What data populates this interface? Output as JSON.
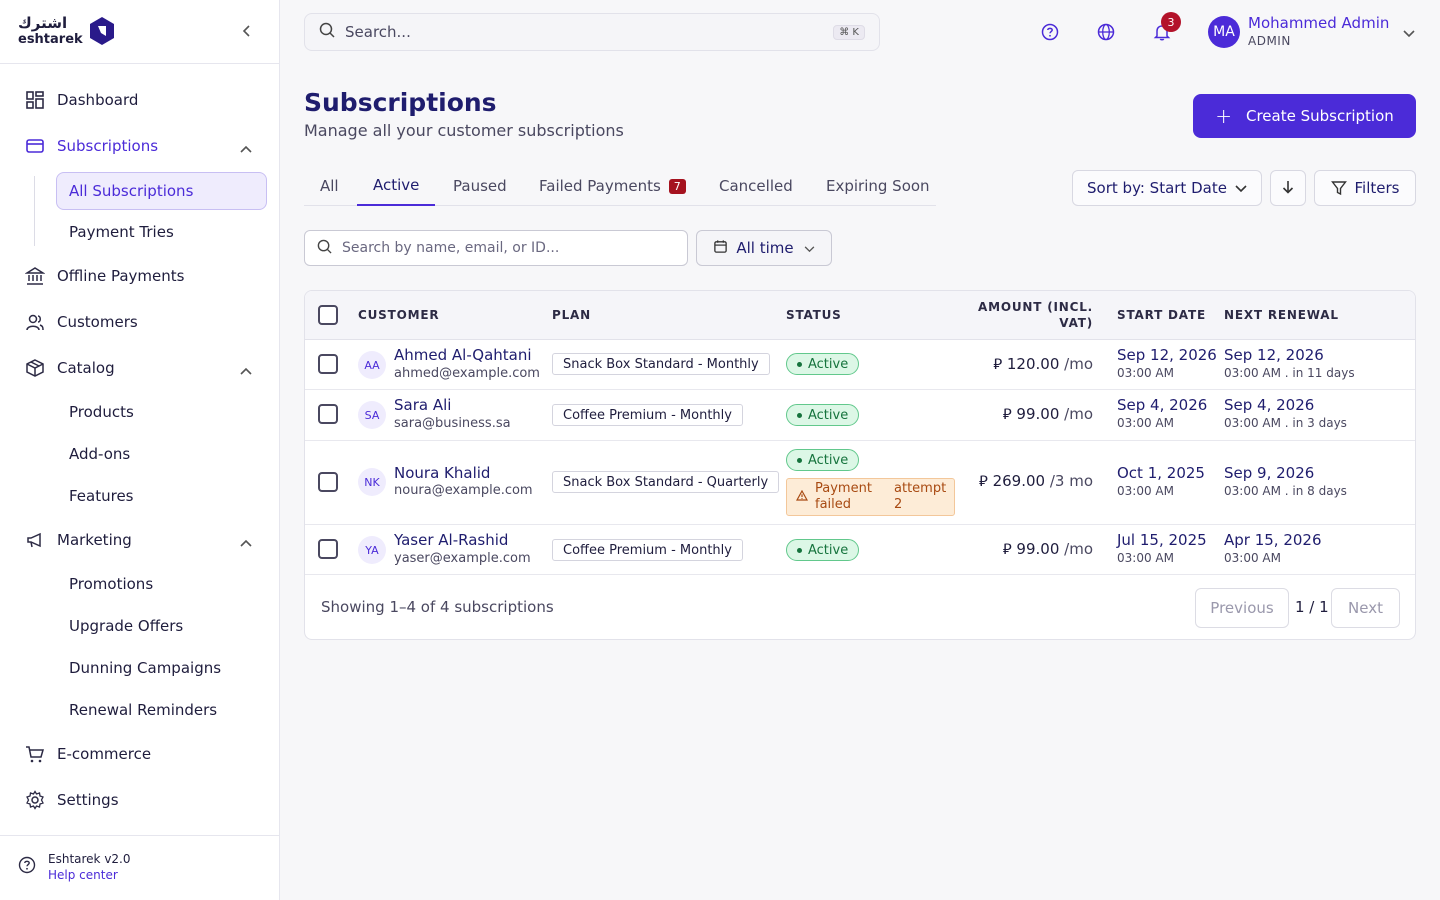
{
  "brand": {
    "arabic": "اشترك",
    "latin": "eshtarek"
  },
  "sidebar": {
    "items": [
      {
        "label": "Dashboard"
      },
      {
        "label": "Subscriptions"
      },
      {
        "label": "Offline Payments"
      },
      {
        "label": "Customers"
      },
      {
        "label": "Catalog"
      },
      {
        "label": "Marketing"
      },
      {
        "label": "E-commerce"
      },
      {
        "label": "Settings"
      }
    ],
    "subscriptions_sub": [
      "All Subscriptions",
      "Payment Tries"
    ],
    "catalog_sub": [
      "Products",
      "Add-ons",
      "Features"
    ],
    "marketing_sub": [
      "Promotions",
      "Upgrade Offers",
      "Dunning Campaigns",
      "Renewal Reminders"
    ],
    "footer": {
      "version": "Eshtarek v2.0",
      "help": "Help center"
    }
  },
  "topbar": {
    "search_placeholder": "Search...",
    "shortcut": "⌘ K",
    "notifications_count": "3",
    "user": {
      "initials": "MA",
      "name": "Mohammed Admin",
      "role": "ADMIN"
    }
  },
  "page": {
    "title": "Subscriptions",
    "subtitle": "Manage all your customer subscriptions",
    "create_label": "Create Subscription"
  },
  "tabs": [
    {
      "label": "All"
    },
    {
      "label": "Active"
    },
    {
      "label": "Paused"
    },
    {
      "label": "Failed Payments",
      "badge": "7"
    },
    {
      "label": "Cancelled"
    },
    {
      "label": "Expiring Soon"
    }
  ],
  "toolbar": {
    "sort_label": "Sort by: Start Date",
    "filters_label": "Filters",
    "search_placeholder": "Search by name, email, or ID...",
    "time_label": "All time"
  },
  "table": {
    "headers": {
      "customer": "CUSTOMER",
      "plan": "PLAN",
      "status": "STATUS",
      "amount_1": "AMOUNT (INCL.",
      "amount_2": "VAT)",
      "start": "START DATE",
      "renewal": "NEXT RENEWAL"
    },
    "rows": [
      {
        "initials": "AA",
        "name": "Ahmed Al-Qahtani",
        "email": "ahmed@example.com",
        "plan": "Snack Box Standard - Monthly",
        "status": "Active",
        "amount": "⃁ 120.00",
        "period": "/mo",
        "start_date": "Sep 12, 2026",
        "start_time": "03:00 AM",
        "renew_date": "Sep 12, 2026",
        "renew_time": "03:00 AM  . in 11 days"
      },
      {
        "initials": "SA",
        "name": "Sara Ali",
        "email": "sara@business.sa",
        "plan": "Coffee Premium - Monthly",
        "status": "Active",
        "amount": "⃁ 99.00",
        "period": "/mo",
        "start_date": "Sep 4, 2026",
        "start_time": "03:00 AM",
        "renew_date": "Sep 4, 2026",
        "renew_time": "03:00 AM  . in 3 days"
      },
      {
        "initials": "NK",
        "name": "Noura Khalid",
        "email": "noura@example.com",
        "plan": "Snack Box Standard - Quarterly",
        "status": "Active",
        "payment_failed_1": "Payment",
        "payment_failed_2": "failed",
        "attempt_1": "attempt",
        "attempt_2": "2",
        "amount": "⃁ 269.00",
        "period": "/3 mo",
        "start_date": "Oct 1, 2025",
        "start_time": "03:00 AM",
        "renew_date": "Sep 9, 2026",
        "renew_time": "03:00 AM  . in 8 days"
      },
      {
        "initials": "YA",
        "name": "Yaser Al-Rashid",
        "email": "yaser@example.com",
        "plan": "Coffee Premium - Monthly",
        "status": "Active",
        "amount": "⃁ 99.00",
        "period": "/mo",
        "start_date": "Jul 15, 2025",
        "start_time": "03:00 AM",
        "renew_date": "Apr 15, 2026",
        "renew_time": "03:00 AM"
      }
    ],
    "footer": {
      "showing": "Showing 1–4 of 4 subscriptions",
      "prev": "Previous",
      "page": "1 / 1",
      "next": "Next"
    }
  },
  "colors": {
    "accent": "#4b2bd8",
    "danger": "#a5121f",
    "success": "#16733d",
    "warning": "#a84a12"
  }
}
